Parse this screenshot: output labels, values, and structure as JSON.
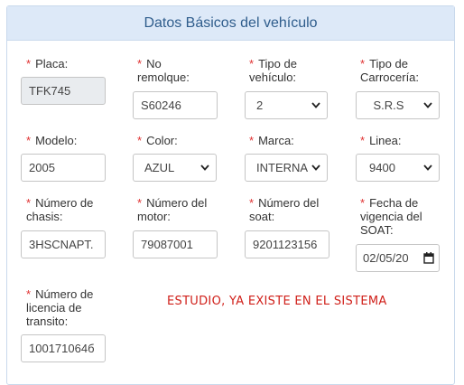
{
  "header": {
    "title": "Datos Básicos del vehículo"
  },
  "fields": {
    "placa": {
      "label": "Placa:",
      "value": "TFK745"
    },
    "remolque": {
      "label_line1": "No",
      "label_line2": "remolque:",
      "value": "S60246"
    },
    "tipo_vehiculo": {
      "label_line1": "Tipo de",
      "label_line2": "vehículo:",
      "value": "2"
    },
    "tipo_carroceria": {
      "label_line1": "Tipo de",
      "label_line2": "Carrocería:",
      "value": "S.R.S"
    },
    "modelo": {
      "label": "Modelo:",
      "value": "2005"
    },
    "color": {
      "label": "Color:",
      "value": "AZUL"
    },
    "marca": {
      "label": "Marca:",
      "value": "INTERNA"
    },
    "linea": {
      "label": "Linea:",
      "value": "9400"
    },
    "chasis": {
      "label_line1": "Número de",
      "label_line2": "chasis:",
      "value": "3HSCNAPT."
    },
    "motor": {
      "label_line1": "Número del",
      "label_line2": "motor:",
      "value": "79087001"
    },
    "soat": {
      "label_line1": "Número del",
      "label_line2": "soat:",
      "value": "9201123156"
    },
    "vigencia_soat": {
      "label_line1": "Fecha de",
      "label_line2": "vigencia del",
      "label_line3": "SOAT:",
      "value": "02/05/20"
    },
    "licencia": {
      "label_line1": "Número de",
      "label_line2": "licencia de",
      "label_line3": "transito:",
      "value": "100171064б"
    }
  },
  "required_marker": "*",
  "notice": "ESTUDIO, YA EXISTE EN EL SISTEMA",
  "colors": {
    "header_bg": "#dde9f8",
    "required": "#e03030",
    "notice": "#d0201a"
  }
}
